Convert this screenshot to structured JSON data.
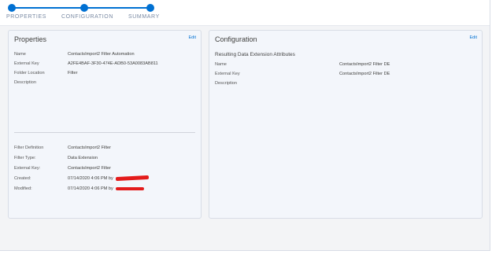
{
  "steps": [
    {
      "label": "PROPERTIES"
    },
    {
      "label": "CONFIGURATION"
    },
    {
      "label": "SUMMARY"
    }
  ],
  "properties": {
    "title": "Properties",
    "edit": "Edit",
    "top": [
      {
        "label": "Name",
        "value": "ContactsImport2 Filter Automation"
      },
      {
        "label": "External Key",
        "value": "A2FE4BAF-3F30-474E-ADB0-53A0083AB811"
      },
      {
        "label": "Folder Location",
        "value": "Filter"
      },
      {
        "label": "Description",
        "value": ""
      }
    ],
    "bottom": [
      {
        "label": "Filter Definition",
        "value": "ContactsImport2 Filter"
      },
      {
        "label": "Filter Type:",
        "value": "Data Extension"
      },
      {
        "label": "External Key:",
        "value": "ContactsImport2 Filter"
      },
      {
        "label": "Created:",
        "value": "07/14/2020 4:06 PM by"
      },
      {
        "label": "Modified:",
        "value": "07/14/2020 4:06 PM by"
      }
    ]
  },
  "configuration": {
    "title": "Configuration",
    "edit": "Edit",
    "subtitle": "Resulting Data Extension Attributes",
    "rows": [
      {
        "label": "Name",
        "value": "ContactsImport2 Filter DE"
      },
      {
        "label": "External Key",
        "value": "ContactsImport2 Filter DE"
      },
      {
        "label": "Description",
        "value": ""
      }
    ]
  }
}
